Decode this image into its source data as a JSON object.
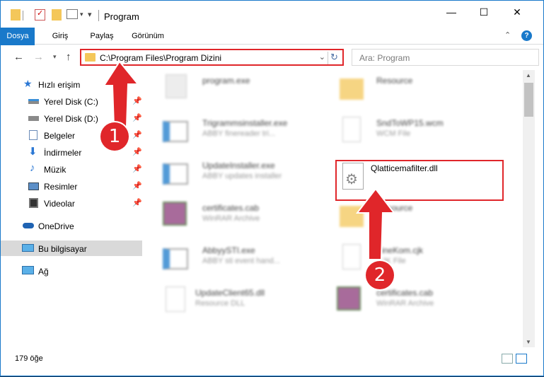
{
  "title": "Program",
  "window_controls": {
    "minimize": "—",
    "maximize": "☐",
    "close": "✕",
    "help": "?",
    "expand": "⌃"
  },
  "ribbon": {
    "tabs": [
      "Dosya",
      "Giriş",
      "Paylaş",
      "Görünüm"
    ]
  },
  "nav": {
    "address": "C:\\Program Files\\Program Dizini",
    "search_placeholder": "Ara: Program"
  },
  "sidebar": {
    "quick_access": "Hızlı erişim",
    "items": [
      {
        "label": "Yerel Disk (C:)",
        "icon": "drive-icon"
      },
      {
        "label": "Yerel Disk (D:)",
        "icon": "drive-icon"
      },
      {
        "label": "Belgeler",
        "icon": "documents-icon"
      },
      {
        "label": "İndirmeler",
        "icon": "downloads-icon"
      },
      {
        "label": "Müzik",
        "icon": "music-icon"
      },
      {
        "label": "Resimler",
        "icon": "pictures-icon"
      },
      {
        "label": "Videolar",
        "icon": "videos-icon"
      }
    ],
    "onedrive": "OneDrive",
    "this_pc": "Bu bilgisayar",
    "network": "Ağ"
  },
  "files": [
    {
      "name": "program.exe",
      "desc": "",
      "icon": "exe-icon",
      "col": 0
    },
    {
      "name": "Resource",
      "desc": "",
      "icon": "folder-icon",
      "col": 1
    },
    {
      "name": "Trigrammsinstaller.exe",
      "desc": "ABBY finereader tri...",
      "icon": "installer-icon",
      "col": 0
    },
    {
      "name": "SndToWP15.wcm",
      "desc": "WCM File",
      "icon": "file-icon",
      "col": 1
    },
    {
      "name": "UpdateInstaller.exe",
      "desc": "ABBY updates installer",
      "icon": "installer-icon",
      "col": 0
    },
    {
      "name": "Qlatticemafilter.dll",
      "desc": "",
      "icon": "dll-icon",
      "col": 1
    },
    {
      "name": "certificates.cab",
      "desc": "WinRAR Archive",
      "icon": "archive-icon",
      "col": 0
    },
    {
      "name": "Resource",
      "desc": "",
      "icon": "folder-icon",
      "col": 1
    },
    {
      "name": "AbbyySTI.exe",
      "desc": "ABBY sti event hand...",
      "icon": "installer-icon",
      "col": 0
    },
    {
      "name": "FineKom.cjk",
      "desc": "CJK File",
      "icon": "file-icon",
      "col": 1
    },
    {
      "name": "UpdateClient65.dll",
      "desc": "Resource DLL",
      "icon": "dll-icon",
      "col": 0
    },
    {
      "name": "certificates.cab",
      "desc": "WinRAR Archive",
      "icon": "archive-icon",
      "col": 1
    }
  ],
  "status": {
    "count": "179 öğe"
  },
  "annotations": {
    "step1": "1",
    "step2": "2"
  },
  "colors": {
    "accent": "#1979ca",
    "highlight": "#e0262a",
    "folder": "#f4c75a"
  }
}
